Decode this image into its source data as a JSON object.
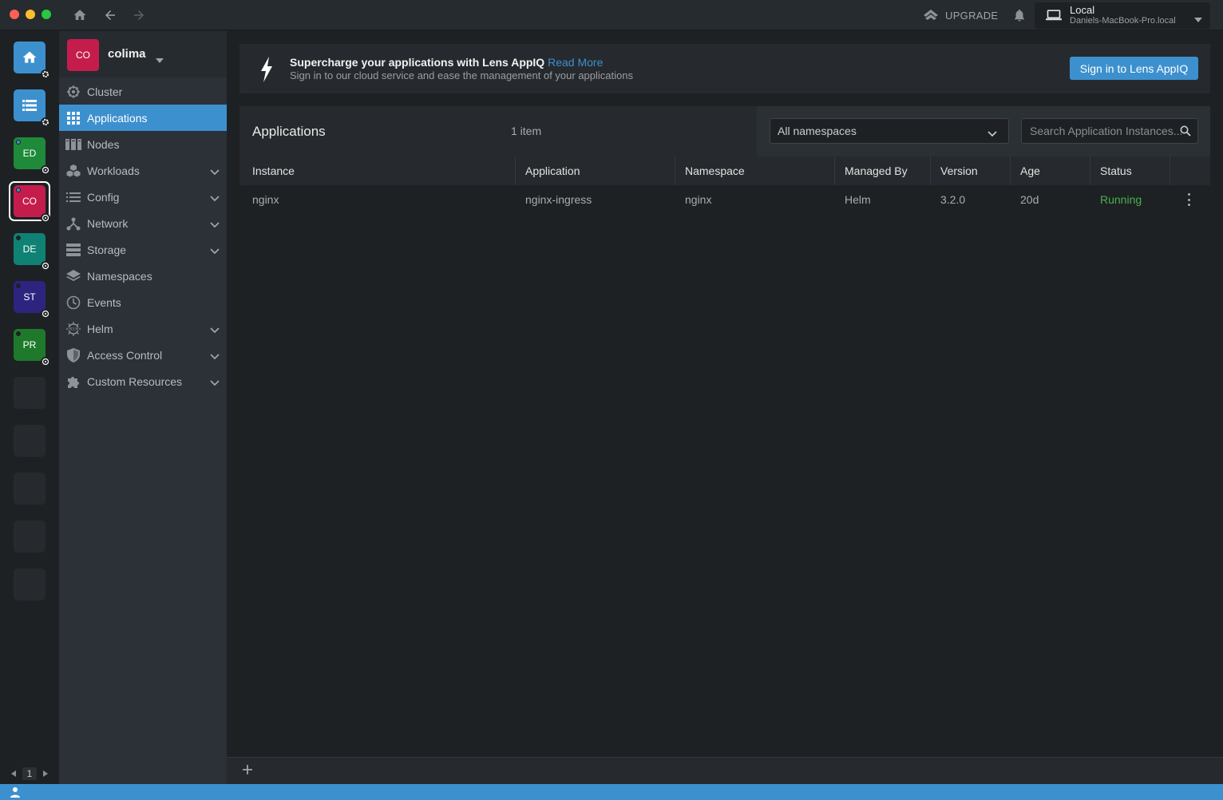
{
  "titlebar": {
    "upgrade_label": "UPGRADE",
    "local_title": "Local",
    "local_subtitle": "Daniels-MacBook-Pro.local"
  },
  "hotbar": {
    "items": [
      {
        "label": "",
        "color": "#3d90ce",
        "icon": "home-icon"
      },
      {
        "label": "",
        "color": "#3d90ce",
        "icon": "catalog-icon"
      },
      {
        "label": "ED",
        "color": "#1e8a3a",
        "status": "#3d90ce"
      },
      {
        "label": "CO",
        "color": "#c41d4c",
        "status": "#3d90ce",
        "active": true
      },
      {
        "label": "DE",
        "color": "#0f8273",
        "status": "#1e2124"
      },
      {
        "label": "ST",
        "color": "#2d2480",
        "status": "#1e2124"
      },
      {
        "label": "PR",
        "color": "#1e7a2a",
        "status": "#1e2124"
      }
    ],
    "page_number": "1"
  },
  "sidebar": {
    "cluster_avatar": "CO",
    "cluster_name": "colima",
    "items": [
      {
        "label": "Cluster",
        "icon": "cluster-icon"
      },
      {
        "label": "Applications",
        "icon": "apps-grid-icon",
        "active": true
      },
      {
        "label": "Nodes",
        "icon": "nodes-icon"
      },
      {
        "label": "Workloads",
        "icon": "workloads-icon",
        "expandable": true
      },
      {
        "label": "Config",
        "icon": "config-icon",
        "expandable": true
      },
      {
        "label": "Network",
        "icon": "network-icon",
        "expandable": true
      },
      {
        "label": "Storage",
        "icon": "storage-icon",
        "expandable": true
      },
      {
        "label": "Namespaces",
        "icon": "namespaces-icon"
      },
      {
        "label": "Events",
        "icon": "clock-icon"
      },
      {
        "label": "Helm",
        "icon": "helm-icon",
        "expandable": true
      },
      {
        "label": "Access Control",
        "icon": "shield-icon",
        "expandable": true
      },
      {
        "label": "Custom Resources",
        "icon": "puzzle-icon",
        "expandable": true
      }
    ]
  },
  "banner": {
    "title": "Supercharge your applications with Lens AppIQ",
    "link": "Read More",
    "subtitle": "Sign in to our cloud service and ease the management of your applications",
    "button": "Sign in to Lens AppIQ"
  },
  "panel": {
    "title": "Applications",
    "count": "1 item",
    "namespace_value": "All namespaces",
    "search_placeholder": "Search Application Instances..."
  },
  "table": {
    "columns": [
      "Instance",
      "Application",
      "Namespace",
      "Managed By",
      "Version",
      "Age",
      "Status"
    ],
    "rows": [
      {
        "instance": "nginx",
        "application": "nginx-ingress",
        "namespace": "nginx",
        "managed_by": "Helm",
        "version": "3.2.0",
        "age": "20d",
        "status": "Running"
      }
    ]
  },
  "colors": {
    "accent": "#3d90ce",
    "running": "#48b14f"
  }
}
